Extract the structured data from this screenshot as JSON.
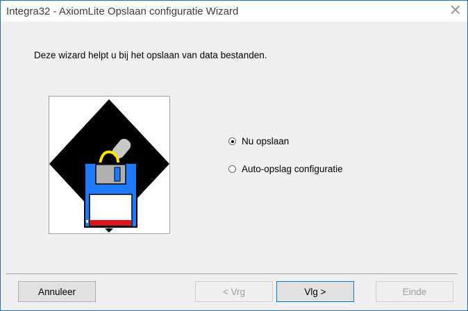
{
  "window": {
    "title": "Integra32 - AxiomLite Opslaan configuratie Wizard",
    "close_glyph": "✕"
  },
  "intro_text": "Deze wizard helpt u bij het opslaan van data bestanden.",
  "options": [
    {
      "label": "Nu opslaan",
      "checked": true
    },
    {
      "label": "Auto-opslag configuratie",
      "checked": false
    }
  ],
  "buttons": {
    "cancel": "Annuleer",
    "back": "< Vrg",
    "next": "Vlg >",
    "finish": "Einde"
  },
  "colors": {
    "accent": "#0078d7",
    "floppy_blue": "#1e7bff",
    "floppy_label": "#e0131b"
  },
  "icons": [
    "close-icon",
    "floppy-disk-icon",
    "radio-checked",
    "radio-unchecked"
  ]
}
